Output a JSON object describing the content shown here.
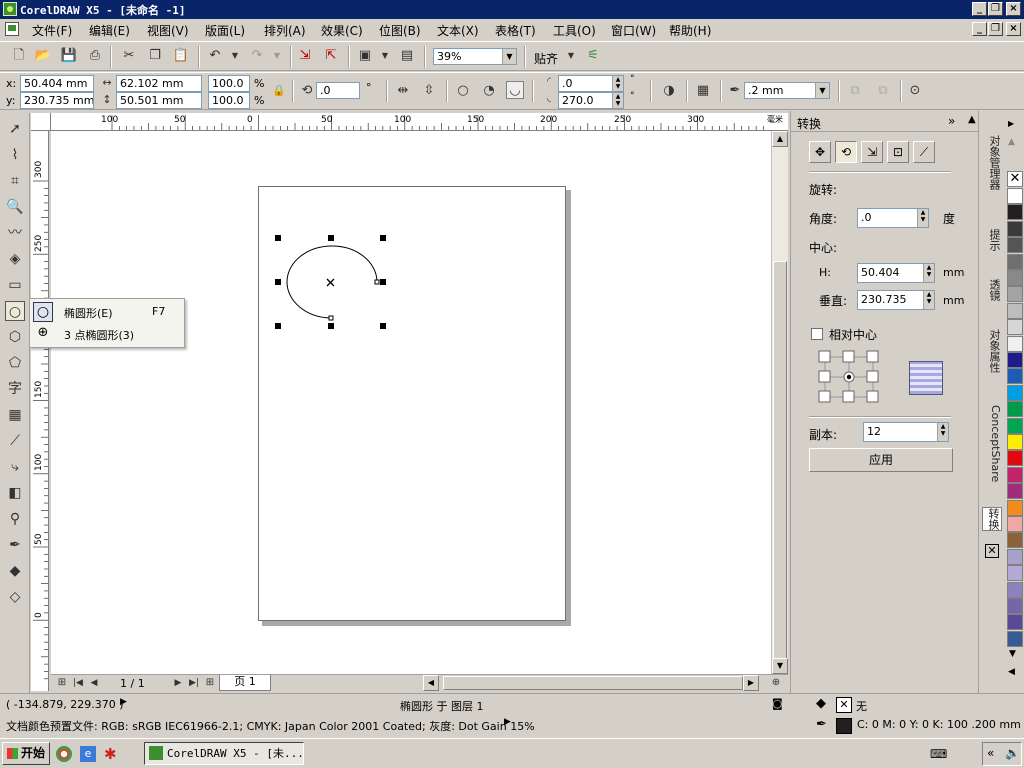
{
  "window": {
    "title": "CorelDRAW X5 - [未命名 -1]"
  },
  "menu": [
    {
      "label": "文件(F)",
      "name": "file"
    },
    {
      "label": "编辑(E)",
      "name": "edit"
    },
    {
      "label": "视图(V)",
      "name": "view"
    },
    {
      "label": "版面(L)",
      "name": "layout"
    },
    {
      "label": "排列(A)",
      "name": "arrange"
    },
    {
      "label": "效果(C)",
      "name": "effects"
    },
    {
      "label": "位图(B)",
      "name": "bitmaps"
    },
    {
      "label": "文本(X)",
      "name": "text"
    },
    {
      "label": "表格(T)",
      "name": "table"
    },
    {
      "label": "工具(O)",
      "name": "tools"
    },
    {
      "label": "窗口(W)",
      "name": "window"
    },
    {
      "label": "帮助(H)",
      "name": "help"
    }
  ],
  "standard_toolbar": {
    "zoom": "39%",
    "snap": "贴齐"
  },
  "property_bar": {
    "x_label": "x:",
    "x_value": "50.404 mm",
    "y_label": "y:",
    "y_value": "230.735 mm",
    "w_value": "62.102 mm",
    "h_value": "50.501 mm",
    "scale_x": "100.0",
    "scale_y": "100.0",
    "pct": "%",
    "rotation": ".0",
    "deg": "°",
    "start_angle": ".0",
    "end_angle": "270.0",
    "outline": ".2 mm"
  },
  "ruler": {
    "h_ticks": [
      "100",
      "50",
      "0",
      "50",
      "100",
      "150",
      "200",
      "250",
      "300"
    ],
    "h_unit": "毫米",
    "v_ticks": [
      "300",
      "250",
      "200",
      "150",
      "100",
      "50",
      "0"
    ]
  },
  "flyout": {
    "items": [
      {
        "label": "椭圆形(E)",
        "shortcut": "F7"
      },
      {
        "label": "3 点椭圆形(3)",
        "shortcut": ""
      }
    ]
  },
  "page_nav": {
    "counter": "1 / 1",
    "tab": "页 1"
  },
  "docker": {
    "title": "转换",
    "section": "旋转:",
    "angle_label": "角度:",
    "angle_value": ".0",
    "angle_unit": "度",
    "center_label": "中心:",
    "h_label": "H:",
    "h_value": "50.404",
    "h_unit": "mm",
    "v_label": "垂直:",
    "v_value": "230.735",
    "v_unit": "mm",
    "relative_center": "相对中心",
    "copies_label": "副本:",
    "copies_value": "12",
    "apply": "应用"
  },
  "side_tabs": [
    "对象管理器",
    "提示",
    "透镜",
    "对象属性",
    "ConceptShare",
    "转换"
  ],
  "palette": [
    "#ffffff",
    "#231f20",
    "#3a3a3a",
    "#555555",
    "#6f6f6f",
    "#898989",
    "#a3a3a3",
    "#bdbdbd",
    "#d6d6d6",
    "#f0f0f0",
    "#1f1a8c",
    "#1e5cb4",
    "#00a0e0",
    "#009a4a",
    "#00a651",
    "#ffed00",
    "#e30613",
    "#c1246b",
    "#a12c7e",
    "#f28c1a",
    "#f2a7a7",
    "#8c6239",
    "#a7a1c9",
    "#b3a8d6",
    "#8c82bd",
    "#7466a8",
    "#5a4a96",
    "#3a5a96"
  ],
  "status": {
    "coords": "( -134.879, 229.370 )",
    "object": "椭圆形 于 图层 1",
    "profile": "文档颜色预置文件: RGB: sRGB IEC61966-2.1; CMYK: Japan Color 2001 Coated; 灰度: Dot Gain 15%",
    "fill": "无",
    "outline_info": "C: 0 M: 0 Y: 0 K: 100  .200 mm"
  },
  "taskbar": {
    "start": "开始",
    "item": "CorelDRAW X5 - [未..."
  },
  "colors": {
    "titlebar": "#0a246a",
    "selection": "#000000"
  }
}
